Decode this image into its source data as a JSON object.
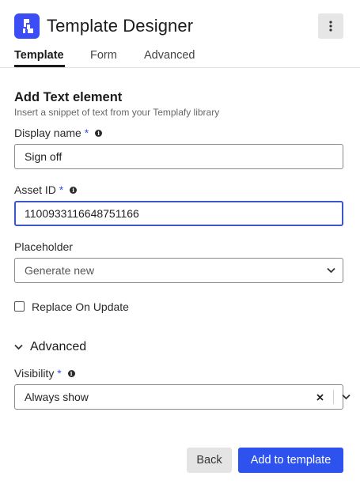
{
  "app": {
    "title": "Template Designer",
    "logo_icon": "templafy-logo-icon",
    "brand_color": "#3b4ef5"
  },
  "header": {
    "menu_icon": "more-vertical-icon"
  },
  "tabs": [
    {
      "label": "Template",
      "active": true
    },
    {
      "label": "Form",
      "active": false
    },
    {
      "label": "Advanced",
      "active": false
    }
  ],
  "section": {
    "title": "Add Text element",
    "subtitle": "Insert a snippet of text from your Templafy library"
  },
  "fields": {
    "display_name": {
      "label": "Display name",
      "required_mark": "*",
      "value": "Sign off"
    },
    "asset_id": {
      "label": "Asset ID",
      "required_mark": "*",
      "value": "1100933116648751166"
    },
    "placeholder": {
      "label": "Placeholder",
      "value": "Generate new"
    }
  },
  "checkbox": {
    "label": "Replace On Update",
    "checked": false
  },
  "advanced": {
    "label": "Advanced",
    "expanded": true,
    "visibility": {
      "label": "Visibility",
      "required_mark": "*",
      "value": "Always show"
    }
  },
  "buttons": {
    "back": "Back",
    "primary": "Add to template"
  }
}
